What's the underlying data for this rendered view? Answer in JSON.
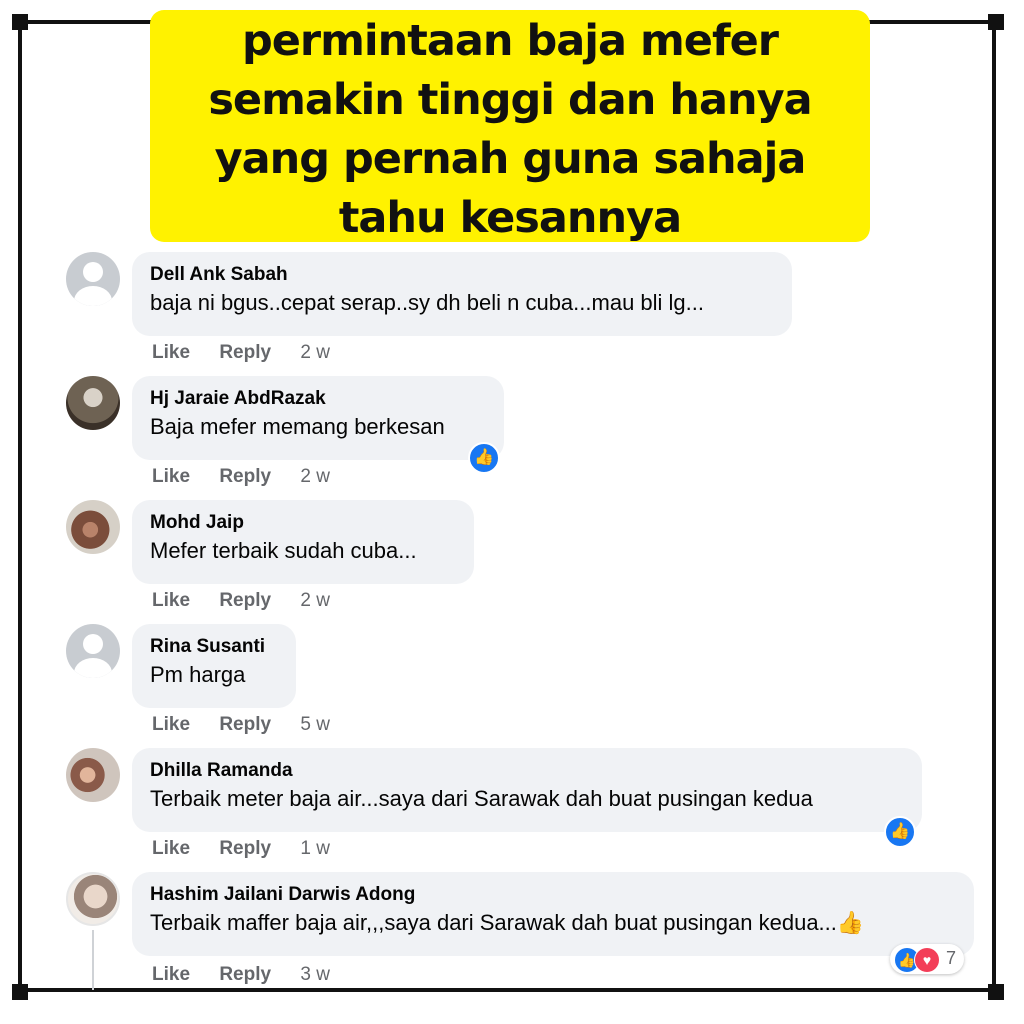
{
  "headline": {
    "lines": [
      "permintaan baja mefer",
      "semakin tinggi dan hanya",
      "yang pernah guna sahaja",
      "tahu kesannya"
    ],
    "background": "#fff200"
  },
  "comments": [
    {
      "author": "Dell Ank Sabah",
      "text": "baja ni bgus..cepat serap..sy dh beli n cuba...mau bli lg...",
      "like_label": "Like",
      "reply_label": "Reply",
      "time": "2 w",
      "avatar": "default-avatar"
    },
    {
      "author": "Hj Jaraie AbdRazak",
      "text": "Baja mefer memang berkesan",
      "like_label": "Like",
      "reply_label": "Reply",
      "time": "2 w",
      "avatar": "photo-avatar",
      "reaction": "like"
    },
    {
      "author": "Mohd Jaip",
      "text": "Mefer terbaik sudah cuba...",
      "like_label": "Like",
      "reply_label": "Reply",
      "time": "2 w",
      "avatar": "photo-avatar"
    },
    {
      "author": "Rina Susanti",
      "text": "Pm harga",
      "like_label": "Like",
      "reply_label": "Reply",
      "time": "5 w",
      "avatar": "default-avatar"
    },
    {
      "author": "Dhilla Ramanda",
      "text": "Terbaik meter baja air...saya dari Sarawak dah buat pusingan kedua",
      "like_label": "Like",
      "reply_label": "Reply",
      "time": "1 w",
      "avatar": "photo-avatar",
      "reaction": "like"
    },
    {
      "author": "Hashim Jailani Darwis Adong",
      "text": "Terbaik maffer baja air,,,saya dari Sarawak dah buat pusingan kedua...",
      "like_label": "Like",
      "reply_label": "Reply",
      "time": "3 w",
      "avatar": "photo-avatar",
      "reactions": [
        "like",
        "love"
      ],
      "reaction_count": "7"
    }
  ],
  "colors": {
    "bubble": "#f0f2f5",
    "like_blue": "#1877f2",
    "love_red": "#f33e58",
    "meta_gray": "#65676b"
  }
}
